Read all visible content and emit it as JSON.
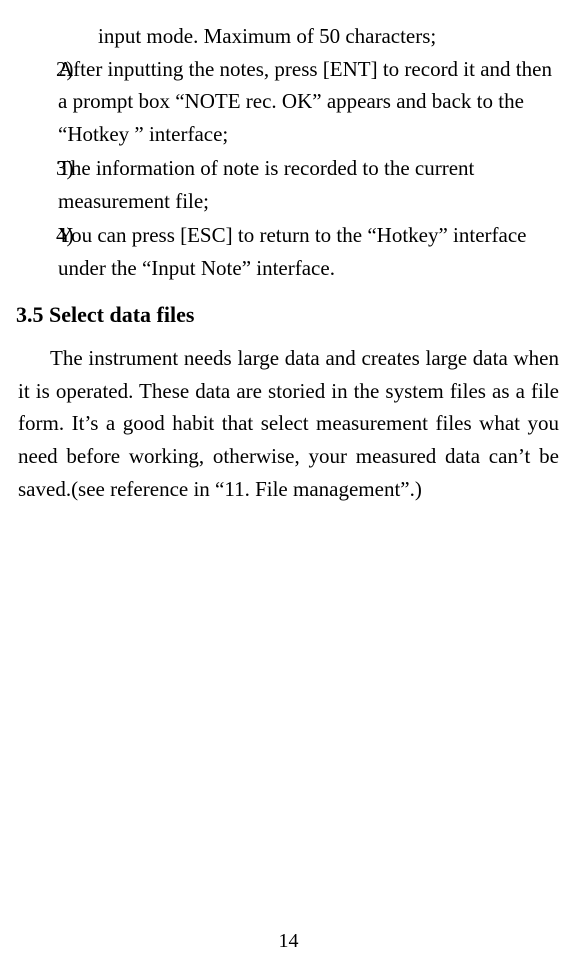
{
  "list": {
    "cont1": "input mode. Maximum of 50 characters;",
    "items": [
      {
        "num": "2)",
        "text": "After inputting the notes, press [ENT] to record it and then a prompt box “NOTE rec. OK” appears and back to the “Hotkey ” interface;"
      },
      {
        "num": "3)",
        "text": "The information of note is recorded to the current measurement file;"
      },
      {
        "num": "4)",
        "text": "You can press [ESC] to return to the “Hotkey” interface under the “Input Note” interface."
      }
    ]
  },
  "section": {
    "heading": "3.5 Select data files",
    "paragraph": "The instrument needs large data and creates large data when it is operated. These data are storied in the system files as a file form. It’s a good habit that select measurement files what you need before working, otherwise, your measured data can’t be saved.(see reference in “11. File management”.)"
  },
  "pageNumber": "14"
}
